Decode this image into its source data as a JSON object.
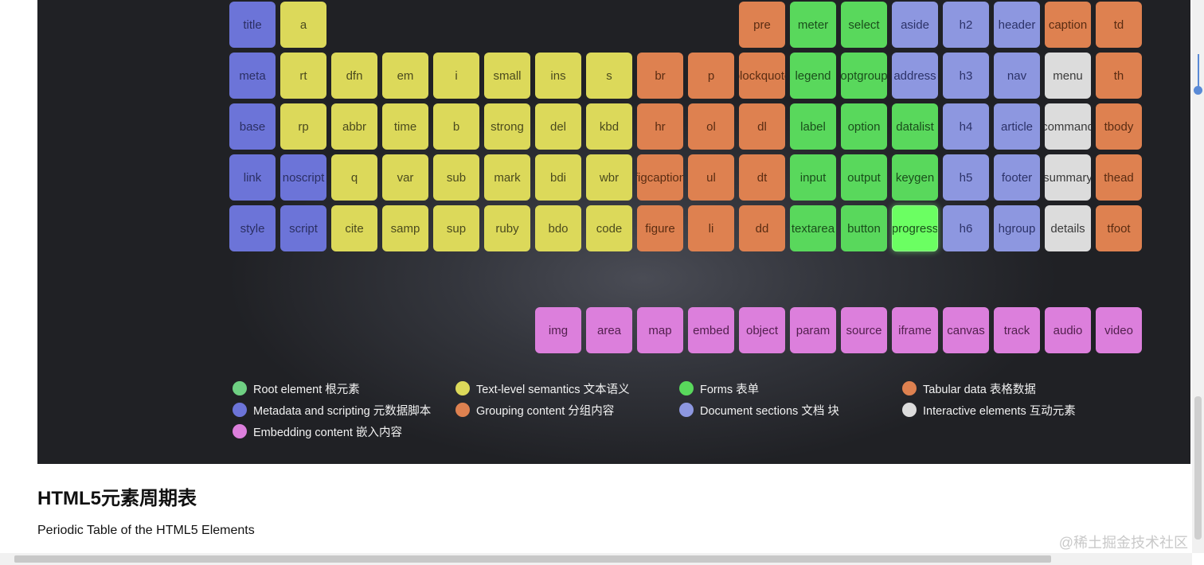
{
  "tiles": [
    {
      "label": "title",
      "cat": "meta",
      "col": 0,
      "row": 0
    },
    {
      "label": "a",
      "cat": "text",
      "col": 1,
      "row": 0
    },
    {
      "label": "pre",
      "cat": "group",
      "col": 10,
      "row": 0
    },
    {
      "label": "meter",
      "cat": "forms",
      "col": 11,
      "row": 0
    },
    {
      "label": "select",
      "cat": "forms",
      "col": 12,
      "row": 0
    },
    {
      "label": "aside",
      "cat": "sections",
      "col": 13,
      "row": 0
    },
    {
      "label": "h2",
      "cat": "sections",
      "col": 14,
      "row": 0
    },
    {
      "label": "header",
      "cat": "sections",
      "col": 15,
      "row": 0
    },
    {
      "label": "caption",
      "cat": "tabular",
      "col": 16,
      "row": 0
    },
    {
      "label": "td",
      "cat": "tabular",
      "col": 17,
      "row": 0
    },
    {
      "label": "meta",
      "cat": "meta",
      "col": 0,
      "row": 1
    },
    {
      "label": "rt",
      "cat": "text",
      "col": 1,
      "row": 1
    },
    {
      "label": "dfn",
      "cat": "text",
      "col": 2,
      "row": 1
    },
    {
      "label": "em",
      "cat": "text",
      "col": 3,
      "row": 1
    },
    {
      "label": "i",
      "cat": "text",
      "col": 4,
      "row": 1
    },
    {
      "label": "small",
      "cat": "text",
      "col": 5,
      "row": 1
    },
    {
      "label": "ins",
      "cat": "text",
      "col": 6,
      "row": 1
    },
    {
      "label": "s",
      "cat": "text",
      "col": 7,
      "row": 1
    },
    {
      "label": "br",
      "cat": "group",
      "col": 8,
      "row": 1
    },
    {
      "label": "p",
      "cat": "group",
      "col": 9,
      "row": 1
    },
    {
      "label": "blockquote",
      "cat": "group",
      "col": 10,
      "row": 1
    },
    {
      "label": "legend",
      "cat": "forms",
      "col": 11,
      "row": 1
    },
    {
      "label": "optgroup",
      "cat": "forms",
      "col": 12,
      "row": 1
    },
    {
      "label": "address",
      "cat": "sections",
      "col": 13,
      "row": 1
    },
    {
      "label": "h3",
      "cat": "sections",
      "col": 14,
      "row": 1
    },
    {
      "label": "nav",
      "cat": "sections",
      "col": 15,
      "row": 1
    },
    {
      "label": "menu",
      "cat": "interactive",
      "col": 16,
      "row": 1
    },
    {
      "label": "th",
      "cat": "tabular",
      "col": 17,
      "row": 1
    },
    {
      "label": "base",
      "cat": "meta",
      "col": 0,
      "row": 2
    },
    {
      "label": "rp",
      "cat": "text",
      "col": 1,
      "row": 2
    },
    {
      "label": "abbr",
      "cat": "text",
      "col": 2,
      "row": 2
    },
    {
      "label": "time",
      "cat": "text",
      "col": 3,
      "row": 2
    },
    {
      "label": "b",
      "cat": "text",
      "col": 4,
      "row": 2
    },
    {
      "label": "strong",
      "cat": "text",
      "col": 5,
      "row": 2
    },
    {
      "label": "del",
      "cat": "text",
      "col": 6,
      "row": 2
    },
    {
      "label": "kbd",
      "cat": "text",
      "col": 7,
      "row": 2
    },
    {
      "label": "hr",
      "cat": "group",
      "col": 8,
      "row": 2
    },
    {
      "label": "ol",
      "cat": "group",
      "col": 9,
      "row": 2
    },
    {
      "label": "dl",
      "cat": "group",
      "col": 10,
      "row": 2
    },
    {
      "label": "label",
      "cat": "forms",
      "col": 11,
      "row": 2
    },
    {
      "label": "option",
      "cat": "forms",
      "col": 12,
      "row": 2
    },
    {
      "label": "datalist",
      "cat": "forms",
      "col": 13,
      "row": 2
    },
    {
      "label": "h4",
      "cat": "sections",
      "col": 14,
      "row": 2
    },
    {
      "label": "article",
      "cat": "sections",
      "col": 15,
      "row": 2
    },
    {
      "label": "command",
      "cat": "interactive",
      "col": 16,
      "row": 2
    },
    {
      "label": "tbody",
      "cat": "tabular",
      "col": 17,
      "row": 2
    },
    {
      "label": "link",
      "cat": "meta",
      "col": 0,
      "row": 3
    },
    {
      "label": "noscript",
      "cat": "meta",
      "col": 1,
      "row": 3
    },
    {
      "label": "q",
      "cat": "text",
      "col": 2,
      "row": 3
    },
    {
      "label": "var",
      "cat": "text",
      "col": 3,
      "row": 3
    },
    {
      "label": "sub",
      "cat": "text",
      "col": 4,
      "row": 3
    },
    {
      "label": "mark",
      "cat": "text",
      "col": 5,
      "row": 3
    },
    {
      "label": "bdi",
      "cat": "text",
      "col": 6,
      "row": 3
    },
    {
      "label": "wbr",
      "cat": "text",
      "col": 7,
      "row": 3
    },
    {
      "label": "figcaption",
      "cat": "group",
      "col": 8,
      "row": 3
    },
    {
      "label": "ul",
      "cat": "group",
      "col": 9,
      "row": 3
    },
    {
      "label": "dt",
      "cat": "group",
      "col": 10,
      "row": 3
    },
    {
      "label": "input",
      "cat": "forms",
      "col": 11,
      "row": 3
    },
    {
      "label": "output",
      "cat": "forms",
      "col": 12,
      "row": 3
    },
    {
      "label": "keygen",
      "cat": "forms",
      "col": 13,
      "row": 3
    },
    {
      "label": "h5",
      "cat": "sections",
      "col": 14,
      "row": 3
    },
    {
      "label": "footer",
      "cat": "sections",
      "col": 15,
      "row": 3
    },
    {
      "label": "summary",
      "cat": "interactive",
      "col": 16,
      "row": 3
    },
    {
      "label": "thead",
      "cat": "tabular",
      "col": 17,
      "row": 3
    },
    {
      "label": "style",
      "cat": "meta",
      "col": 0,
      "row": 4
    },
    {
      "label": "script",
      "cat": "meta",
      "col": 1,
      "row": 4
    },
    {
      "label": "cite",
      "cat": "text",
      "col": 2,
      "row": 4
    },
    {
      "label": "samp",
      "cat": "text",
      "col": 3,
      "row": 4
    },
    {
      "label": "sup",
      "cat": "text",
      "col": 4,
      "row": 4
    },
    {
      "label": "ruby",
      "cat": "text",
      "col": 5,
      "row": 4
    },
    {
      "label": "bdo",
      "cat": "text",
      "col": 6,
      "row": 4
    },
    {
      "label": "code",
      "cat": "text",
      "col": 7,
      "row": 4
    },
    {
      "label": "figure",
      "cat": "group",
      "col": 8,
      "row": 4
    },
    {
      "label": "li",
      "cat": "group",
      "col": 9,
      "row": 4
    },
    {
      "label": "dd",
      "cat": "group",
      "col": 10,
      "row": 4
    },
    {
      "label": "textarea",
      "cat": "forms",
      "col": 11,
      "row": 4
    },
    {
      "label": "button",
      "cat": "forms",
      "col": 12,
      "row": 4
    },
    {
      "label": "progress",
      "cat": "forms",
      "col": 13,
      "row": 4,
      "highlight": true
    },
    {
      "label": "h6",
      "cat": "sections",
      "col": 14,
      "row": 4
    },
    {
      "label": "hgroup",
      "cat": "sections",
      "col": 15,
      "row": 4
    },
    {
      "label": "details",
      "cat": "interactive",
      "col": 16,
      "row": 4
    },
    {
      "label": "tfoot",
      "cat": "tabular",
      "col": 17,
      "row": 4
    },
    {
      "label": "img",
      "cat": "embed",
      "col": 6,
      "row": 6
    },
    {
      "label": "area",
      "cat": "embed",
      "col": 7,
      "row": 6
    },
    {
      "label": "map",
      "cat": "embed",
      "col": 8,
      "row": 6
    },
    {
      "label": "embed",
      "cat": "embed",
      "col": 9,
      "row": 6
    },
    {
      "label": "object",
      "cat": "embed",
      "col": 10,
      "row": 6
    },
    {
      "label": "param",
      "cat": "embed",
      "col": 11,
      "row": 6
    },
    {
      "label": "source",
      "cat": "embed",
      "col": 12,
      "row": 6
    },
    {
      "label": "iframe",
      "cat": "embed",
      "col": 13,
      "row": 6
    },
    {
      "label": "canvas",
      "cat": "embed",
      "col": 14,
      "row": 6
    },
    {
      "label": "track",
      "cat": "embed",
      "col": 15,
      "row": 6
    },
    {
      "label": "audio",
      "cat": "embed",
      "col": 16,
      "row": 6
    },
    {
      "label": "video",
      "cat": "embed",
      "col": 17,
      "row": 6
    }
  ],
  "legend": [
    {
      "label": "Root element 根元素",
      "color": "#6fd083",
      "col": 0,
      "row": 0
    },
    {
      "label": "Text-level semantics 文本语义",
      "color": "#dcd95a",
      "col": 1,
      "row": 0
    },
    {
      "label": "Forms 表单",
      "color": "#59d85c",
      "col": 2,
      "row": 0
    },
    {
      "label": "Tabular data 表格数据",
      "color": "#de8150",
      "col": 3,
      "row": 0
    },
    {
      "label": "Metadata and scripting 元数据脚本",
      "color": "#6c74d8",
      "col": 0,
      "row": 1
    },
    {
      "label": "Grouping content 分组内容",
      "color": "#de8150",
      "col": 1,
      "row": 1
    },
    {
      "label": "Document sections 文档 块",
      "color": "#8d97e0",
      "col": 2,
      "row": 1
    },
    {
      "label": "Interactive elements 互动元素",
      "color": "#dcdcdc",
      "col": 3,
      "row": 1
    },
    {
      "label": "Embedding content 嵌入内容",
      "color": "#dc7fdc",
      "col": 0,
      "row": 2
    }
  ],
  "page": {
    "title": "HTML5元素周期表",
    "subtitle": "Periodic Table of the HTML5 Elements",
    "watermark": "@稀土掘金技术社区"
  }
}
